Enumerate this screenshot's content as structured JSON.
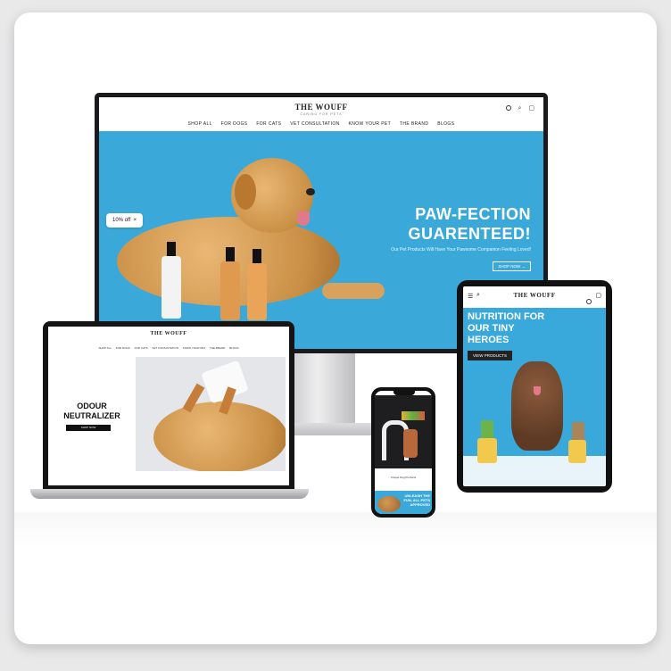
{
  "brand": {
    "name": "THE WOUFF",
    "tagline": "CARING FOR PETS"
  },
  "monitor": {
    "nav": [
      "SHOP ALL",
      "FOR DOGS",
      "FOR CATS",
      "VET CONSULTATION",
      "KNOW YOUR PET",
      "THE BRAND",
      "BLOGS"
    ],
    "hero_line1": "PAW-FECTION",
    "hero_line2": "GUARENTEED!",
    "hero_sub": "Our Pet Products Will Have Your Pawsome Companion Feeling Loved!",
    "cta": "SHOP NOW →",
    "badge": "10% off",
    "badge_close": "×"
  },
  "laptop": {
    "nav": [
      "SHOP ALL",
      "FOR DOGS",
      "FOR CATS",
      "VET CONSULTATION",
      "KNOW YOUR PET",
      "THE BRAND",
      "BLOGS"
    ],
    "title_line1": "ODOUR",
    "title_line2": "NEUTRALIZER",
    "button": "SHOP NOW"
  },
  "tablet": {
    "hero_line1": "NUTRITION FOR",
    "hero_line2": "OUR TINY",
    "hero_line3": "HEROES",
    "button": "VIEW PRODUCTS"
  },
  "phone": {
    "caption": "Unique Dog Products",
    "promo": "UNLEASH THE FUN, ALL PETS APPROVED"
  },
  "colors": {
    "hero_blue": "#3aa9d9",
    "dark": "#1b1b1d",
    "dog_gold": "#d9a25c"
  }
}
